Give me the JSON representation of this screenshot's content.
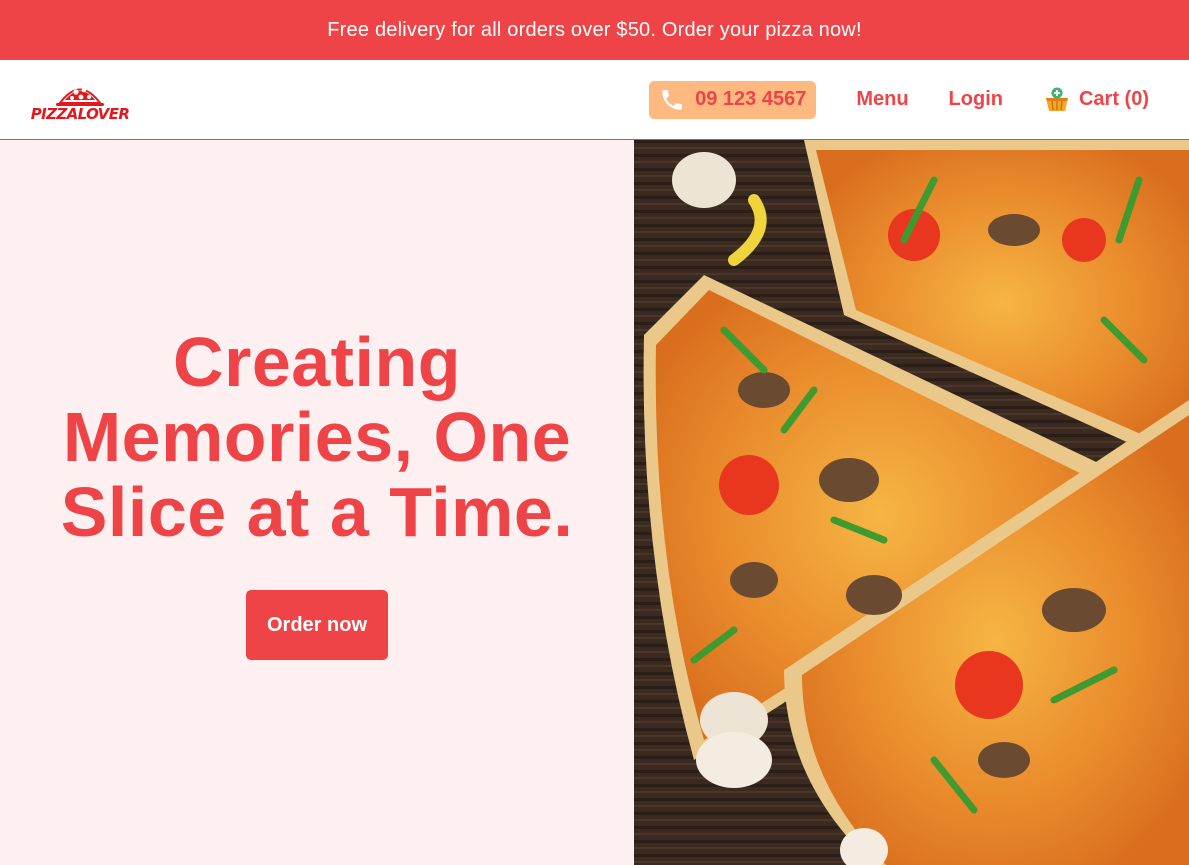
{
  "promo_banner": {
    "text": "Free delivery for all orders over $50. Order your pizza now!"
  },
  "header": {
    "logo_text": "PIZZALOVER",
    "phone_number": "09 123 4567",
    "nav": {
      "menu": "Menu",
      "login": "Login",
      "cart": "Cart (0)"
    }
  },
  "hero": {
    "title_lines": [
      "Creating",
      "Memories, One",
      "Slice at a Time."
    ],
    "cta_label": "Order now",
    "image_icon": "pizza-photo"
  },
  "colors": {
    "brand_red": "#ef4447",
    "hero_bg": "#fef0f0",
    "phone_bg": "#fdb97f"
  }
}
